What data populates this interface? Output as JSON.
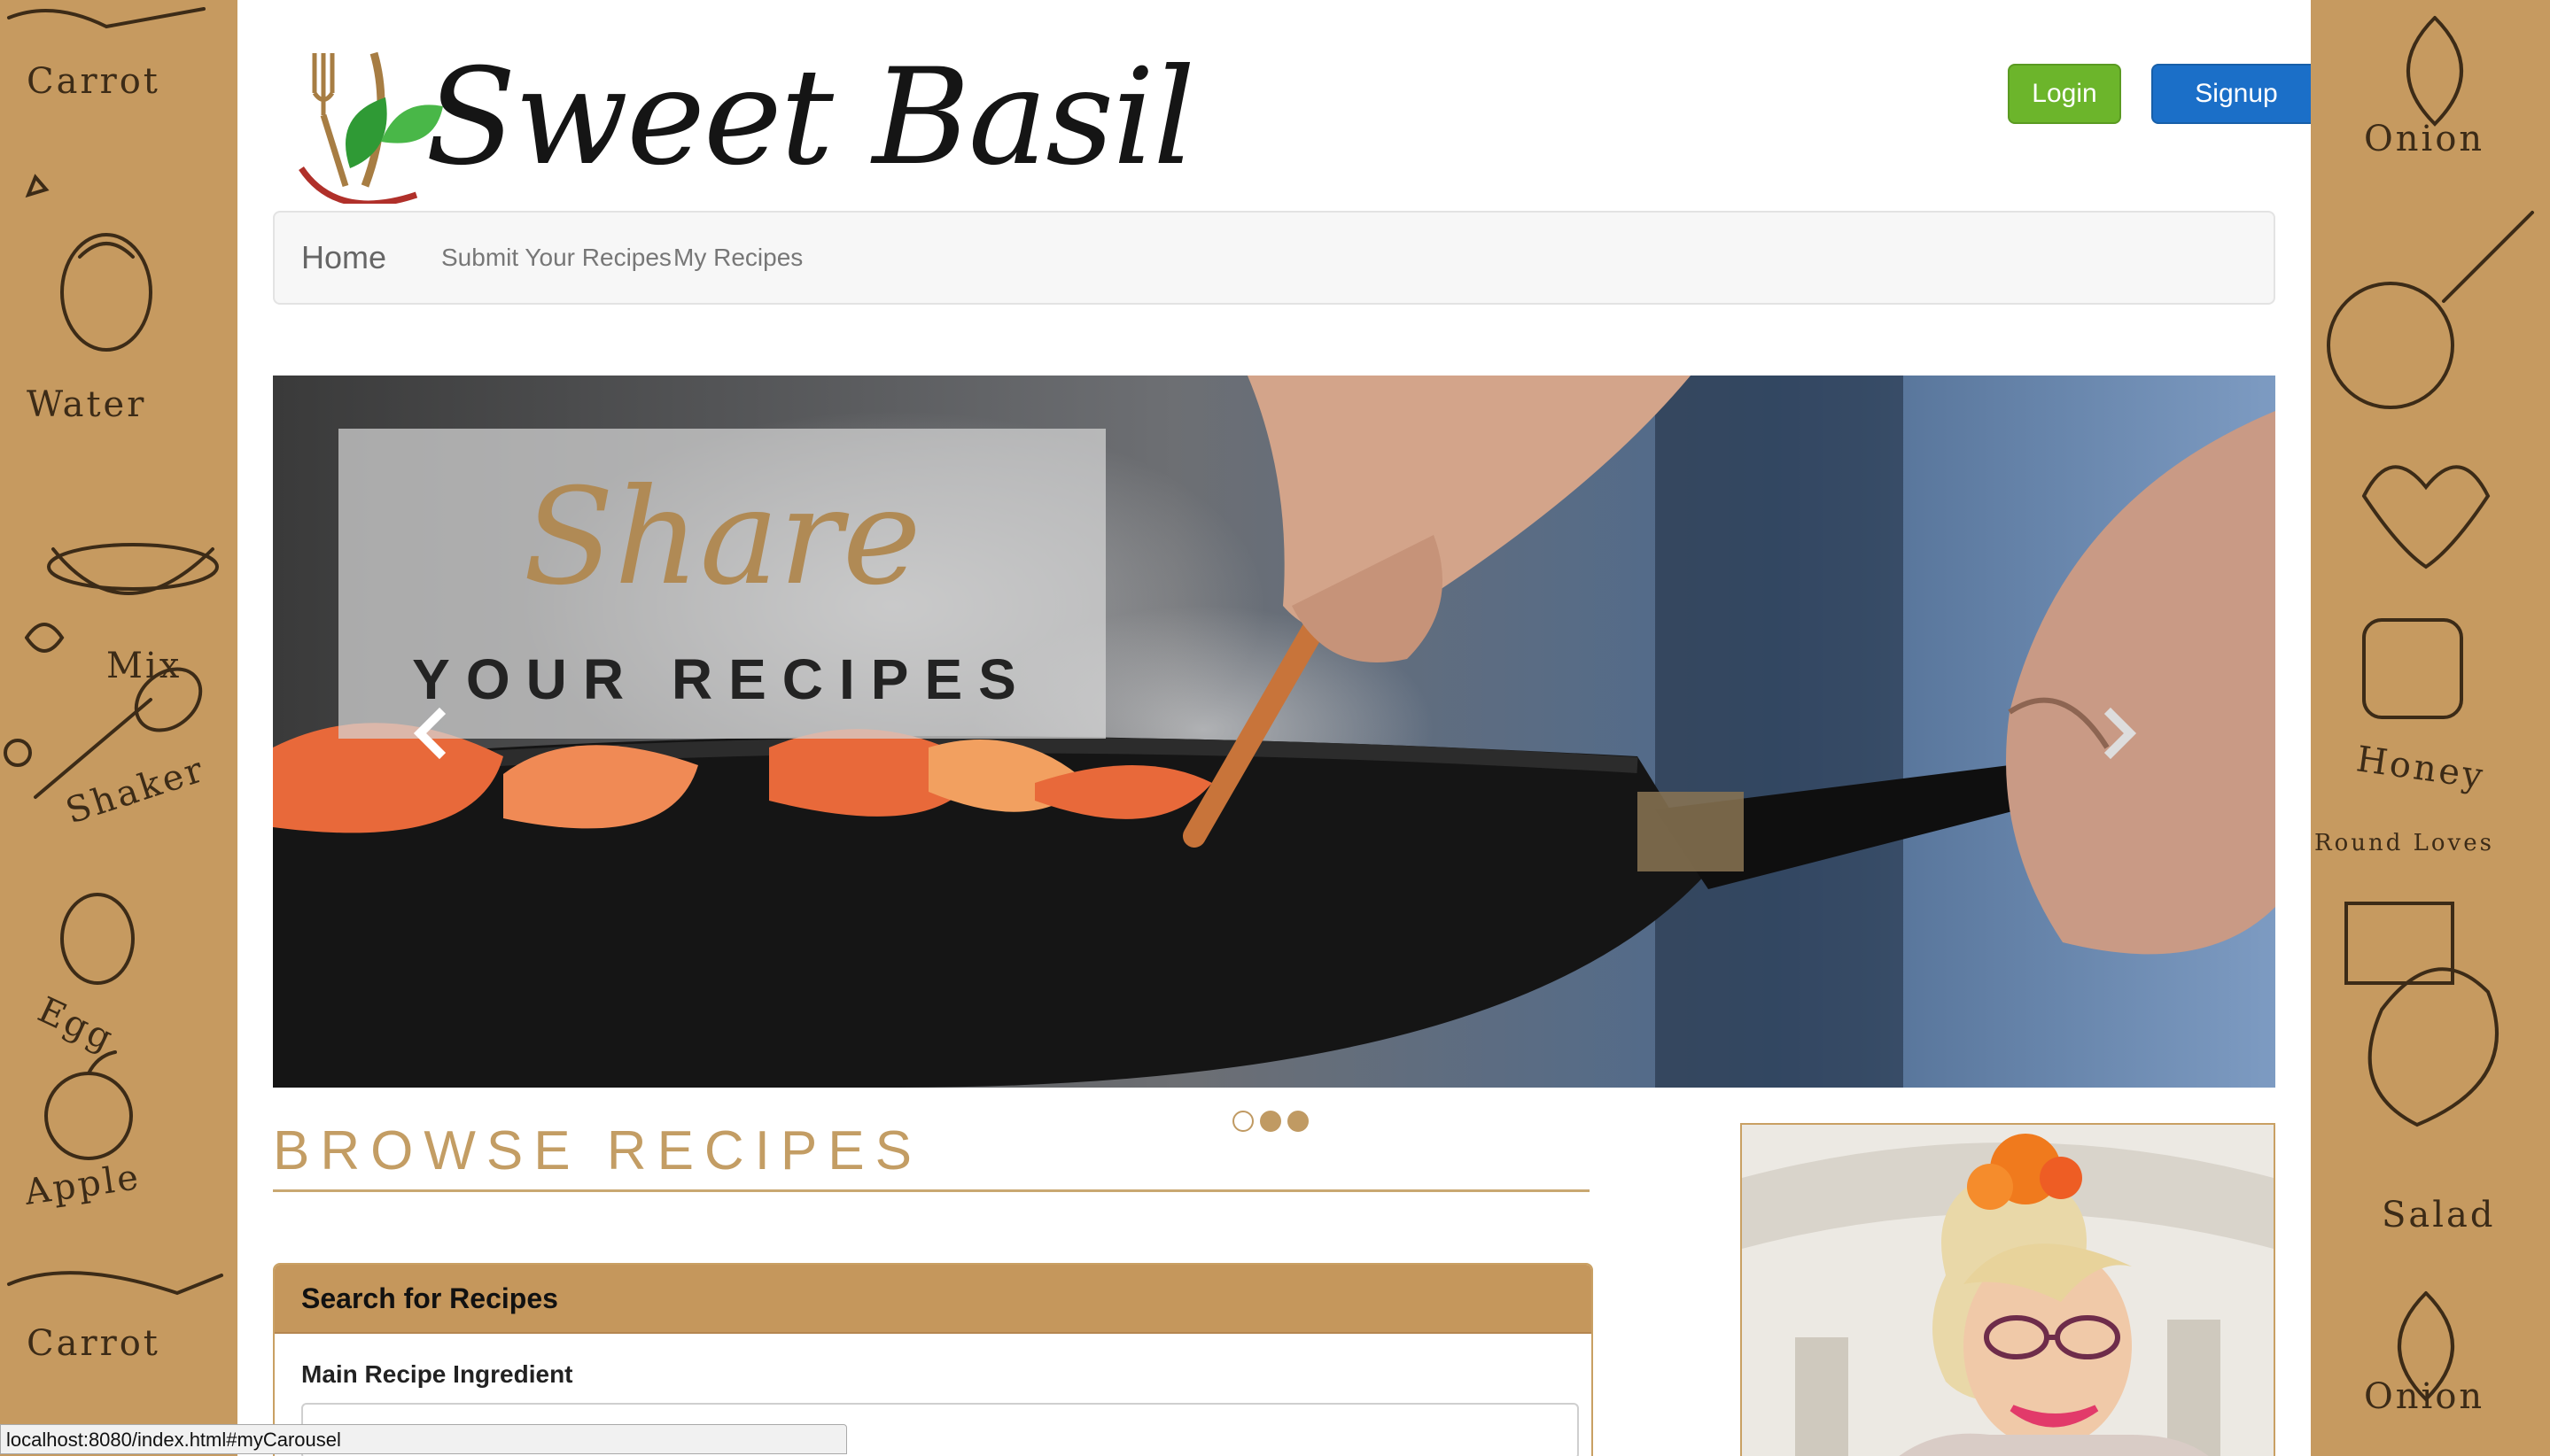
{
  "brand": {
    "name": "Sweet Basil",
    "logo_icon": "fork-knife-basil-leaf-icon"
  },
  "header": {
    "login_label": "Login",
    "signup_label": "Signup"
  },
  "nav": {
    "items": [
      {
        "label": "Home"
      },
      {
        "label": "Submit Your Recipes"
      },
      {
        "label": "My Recipes"
      }
    ]
  },
  "carousel": {
    "caption_script": "Share",
    "caption_sub": "YOUR RECIPES",
    "prev_icon": "chevron-left-icon",
    "next_icon": "chevron-right-icon",
    "slide_count": 3,
    "active_slide": 1
  },
  "doodles": {
    "left": [
      "Carrot",
      "Water",
      "Mix",
      "Shaker",
      "Egg",
      "Apple",
      "Carrot"
    ],
    "right": [
      "Onion",
      "Honey",
      "Round Loves",
      "Salad",
      "Onion"
    ]
  },
  "browse": {
    "title": "BROWSE RECIPES"
  },
  "search_panel": {
    "heading": "Search for Recipes",
    "field_label": "Main Recipe Ingredient",
    "field_value": ""
  },
  "statusbar": {
    "url": "localhost:8080/index.html#myCarousel"
  },
  "colors": {
    "accent_tan": "#c5975c",
    "login_green": "#6cb52b",
    "signup_blue": "#1b6fc8",
    "title_gold": "#c39d64"
  }
}
